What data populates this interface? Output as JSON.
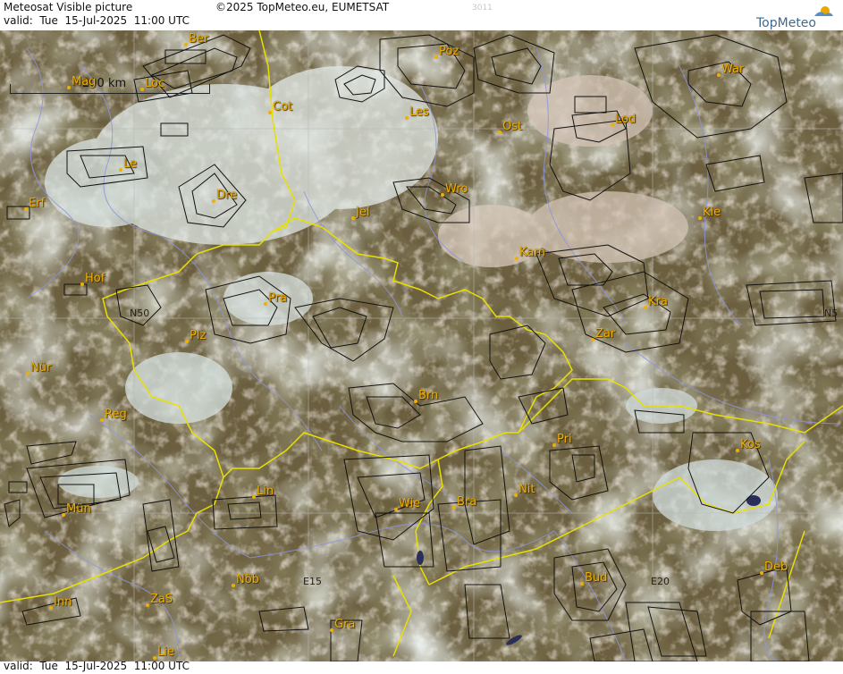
{
  "header": {
    "title": "Meteosat Visible picture",
    "valid": "valid:  Tue  15-Jul-2025  11:00 UTC",
    "copyright": "©2025 TopMeteo.eu, EUMETSAT",
    "station_id": "3011",
    "logo": "TopMeteo"
  },
  "footer": {
    "valid": "valid:  Tue  15-Jul-2025  11:00 UTC"
  },
  "scale": {
    "label": "200 km"
  },
  "colors": {
    "city": "#f0b000",
    "border": "#e8e000",
    "river": "#8c94e0",
    "airspace": "#111111",
    "land": "#5e5436",
    "cloud": "#dde6e6"
  },
  "cities": [
    {
      "name": "Ber"
    },
    {
      "name": "Mag"
    },
    {
      "name": "Loc"
    },
    {
      "name": "Cot"
    },
    {
      "name": "Poz"
    },
    {
      "name": "Les"
    },
    {
      "name": "Ost"
    },
    {
      "name": "Lod"
    },
    {
      "name": "War"
    },
    {
      "name": "Le"
    },
    {
      "name": "Dre"
    },
    {
      "name": "Erf"
    },
    {
      "name": "Jel"
    },
    {
      "name": "Wro"
    },
    {
      "name": "Kie"
    },
    {
      "name": "Kam"
    },
    {
      "name": "Hof"
    },
    {
      "name": "Pra"
    },
    {
      "name": "Kra"
    },
    {
      "name": "Plz"
    },
    {
      "name": "Zar"
    },
    {
      "name": "Nür"
    },
    {
      "name": "Brn"
    },
    {
      "name": "Reg"
    },
    {
      "name": "Pri"
    },
    {
      "name": "Kos"
    },
    {
      "name": "Lin"
    },
    {
      "name": "Nit"
    },
    {
      "name": "Mün"
    },
    {
      "name": "Wie"
    },
    {
      "name": "Bra"
    },
    {
      "name": "Deb"
    },
    {
      "name": "Nöb"
    },
    {
      "name": "Bud"
    },
    {
      "name": "Inn"
    },
    {
      "name": "ZaS"
    },
    {
      "name": "Gra"
    },
    {
      "name": "Lie"
    }
  ],
  "grid_labels": [
    {
      "text": "N50"
    },
    {
      "text": "N5"
    },
    {
      "text": "E15"
    },
    {
      "text": "E20"
    }
  ]
}
